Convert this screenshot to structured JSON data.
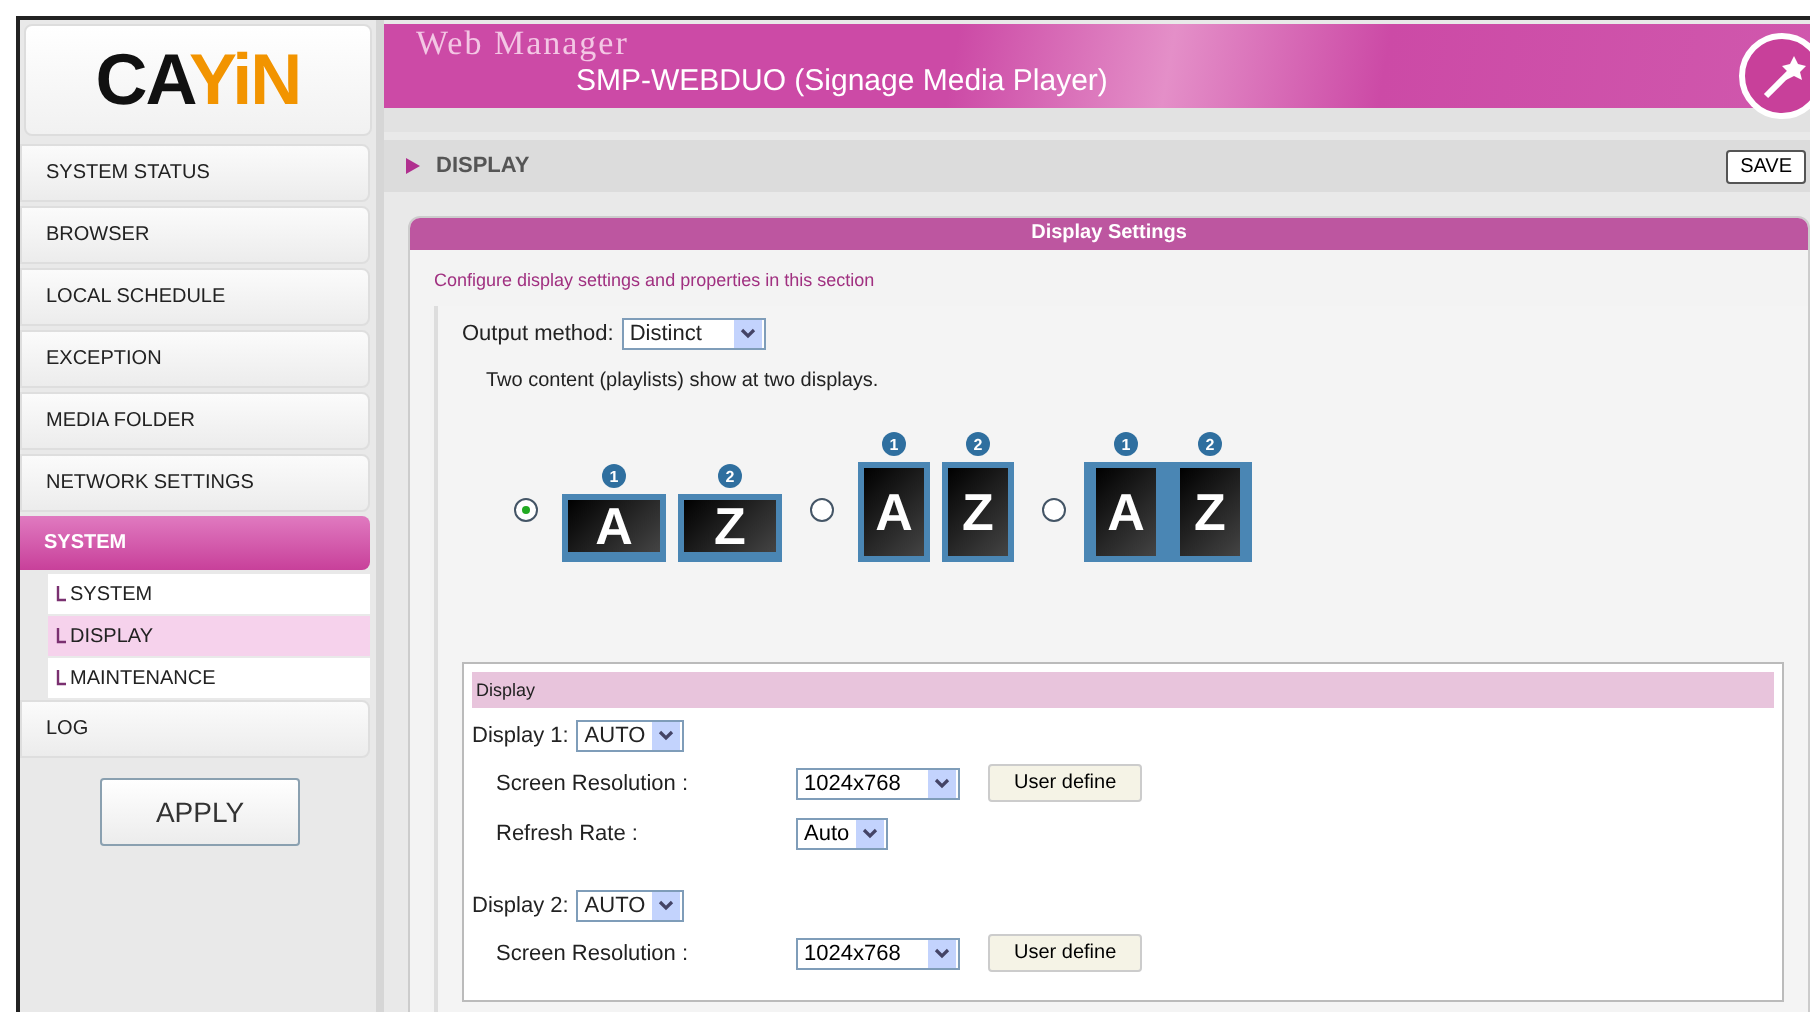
{
  "header": {
    "logo": "CAYiN",
    "title": "Web Manager",
    "subtitle": "SMP-WEBDUO (Signage Media Player)"
  },
  "sidebar": {
    "items": [
      {
        "label": "SYSTEM STATUS",
        "selected": false
      },
      {
        "label": "BROWSER",
        "selected": false
      },
      {
        "label": "LOCAL SCHEDULE",
        "selected": false
      },
      {
        "label": "EXCEPTION",
        "selected": false
      },
      {
        "label": "MEDIA FOLDER",
        "selected": false
      },
      {
        "label": "NETWORK SETTINGS",
        "selected": false
      },
      {
        "label": "SYSTEM",
        "selected": true,
        "children": [
          {
            "label": "SYSTEM",
            "selected": false
          },
          {
            "label": "DISPLAY",
            "selected": true
          },
          {
            "label": "MAINTENANCE",
            "selected": false
          }
        ]
      },
      {
        "label": "LOG",
        "selected": false
      }
    ],
    "apply_button": "APPLY"
  },
  "breadcrumb": "DISPLAY",
  "save_button": "SAVE",
  "panel": {
    "title": "Display Settings",
    "description": "Configure display settings and properties in this section",
    "output_method": {
      "label": "Output method:",
      "value": "Distinct"
    },
    "note": "Two content (playlists) show at two displays.",
    "layouts": [
      {
        "kind": "landscape",
        "selected": true,
        "screens": [
          {
            "badge": "1",
            "letter": "A"
          },
          {
            "badge": "2",
            "letter": "Z"
          }
        ]
      },
      {
        "kind": "portrait",
        "selected": false,
        "screens": [
          {
            "badge": "1",
            "letter": "A"
          },
          {
            "badge": "2",
            "letter": "Z"
          }
        ]
      },
      {
        "kind": "rotated",
        "selected": false,
        "screens": [
          {
            "badge": "1",
            "letter": "A"
          },
          {
            "badge": "2",
            "letter": "Z"
          }
        ]
      }
    ],
    "display_section": {
      "title": "Display",
      "displays": [
        {
          "label": "Display 1:",
          "mode": "AUTO",
          "rows": [
            {
              "label": "Screen Resolution :",
              "value": "1024x768",
              "button": "User define"
            },
            {
              "label": "Refresh Rate :",
              "value": "Auto"
            }
          ]
        },
        {
          "label": "Display 2:",
          "mode": "AUTO",
          "rows": [
            {
              "label": "Screen Resolution :",
              "value": "1024x768",
              "button": "User define"
            }
          ]
        }
      ]
    }
  }
}
